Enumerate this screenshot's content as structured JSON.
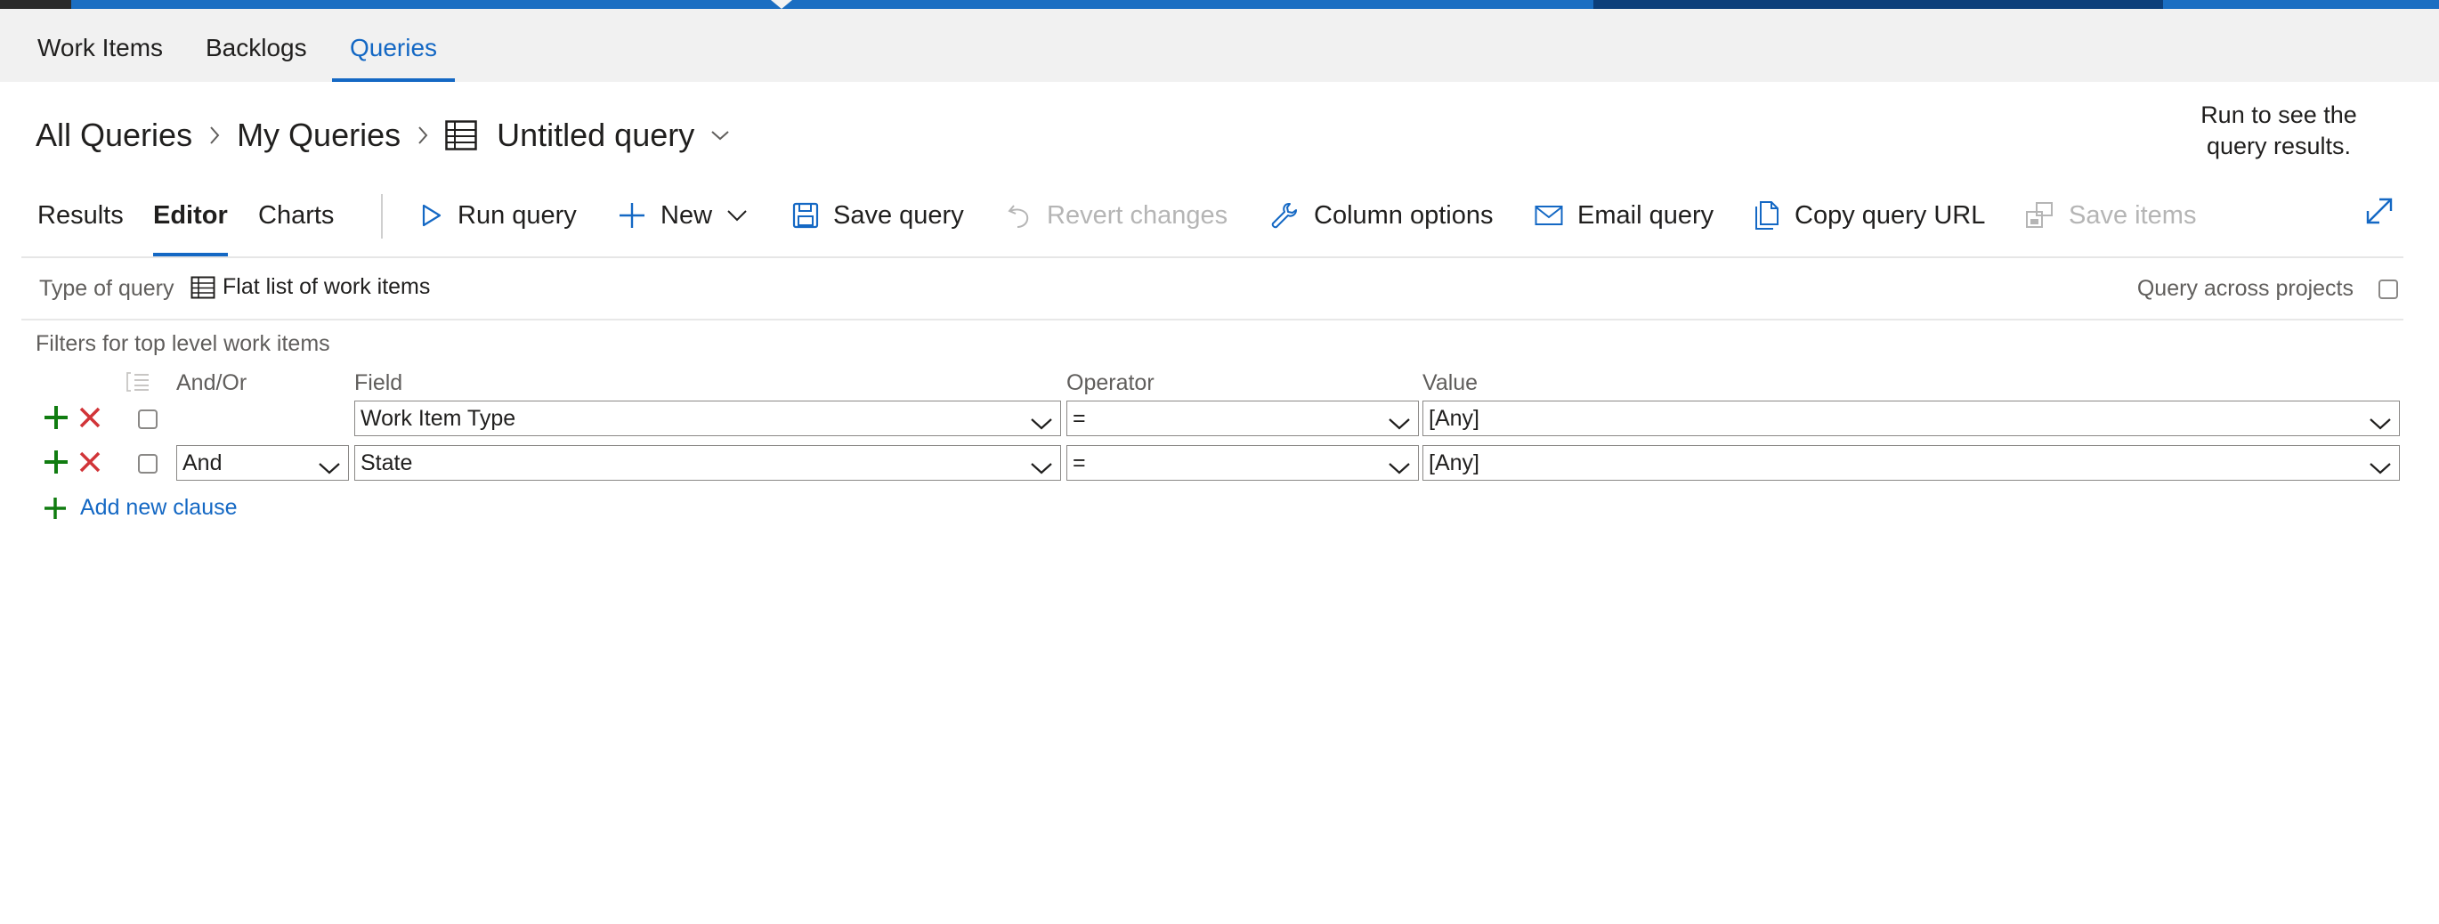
{
  "nav": {
    "tabs": [
      {
        "label": "Work Items"
      },
      {
        "label": "Backlogs"
      },
      {
        "label": "Queries"
      }
    ]
  },
  "breadcrumb": {
    "root": "All Queries",
    "folder": "My Queries",
    "current": "Untitled query"
  },
  "run_hint": "Run to see the query results.",
  "view_tabs": [
    {
      "label": "Results"
    },
    {
      "label": "Editor"
    },
    {
      "label": "Charts"
    }
  ],
  "toolbar": {
    "run_query": "Run query",
    "new": "New",
    "save_query": "Save query",
    "revert_changes": "Revert changes",
    "column_options": "Column options",
    "email_query": "Email query",
    "copy_query_url": "Copy query URL",
    "save_items": "Save items"
  },
  "query_type": {
    "label": "Type of query",
    "value": "Flat list of work items",
    "across_projects": "Query across projects"
  },
  "filters": {
    "title": "Filters for top level work items",
    "headers": {
      "andor": "And/Or",
      "field": "Field",
      "operator": "Operator",
      "value": "Value"
    },
    "clauses": [
      {
        "andor": "",
        "field": "Work Item Type",
        "operator": "=",
        "value": "[Any]"
      },
      {
        "andor": "And",
        "field": "State",
        "operator": "=",
        "value": "[Any]"
      }
    ],
    "add_clause": "Add new clause"
  },
  "colors": {
    "accent": "#1468c4",
    "add_green": "#107c10",
    "delete_red": "#d13438",
    "disabled": "#b5b5b5"
  }
}
